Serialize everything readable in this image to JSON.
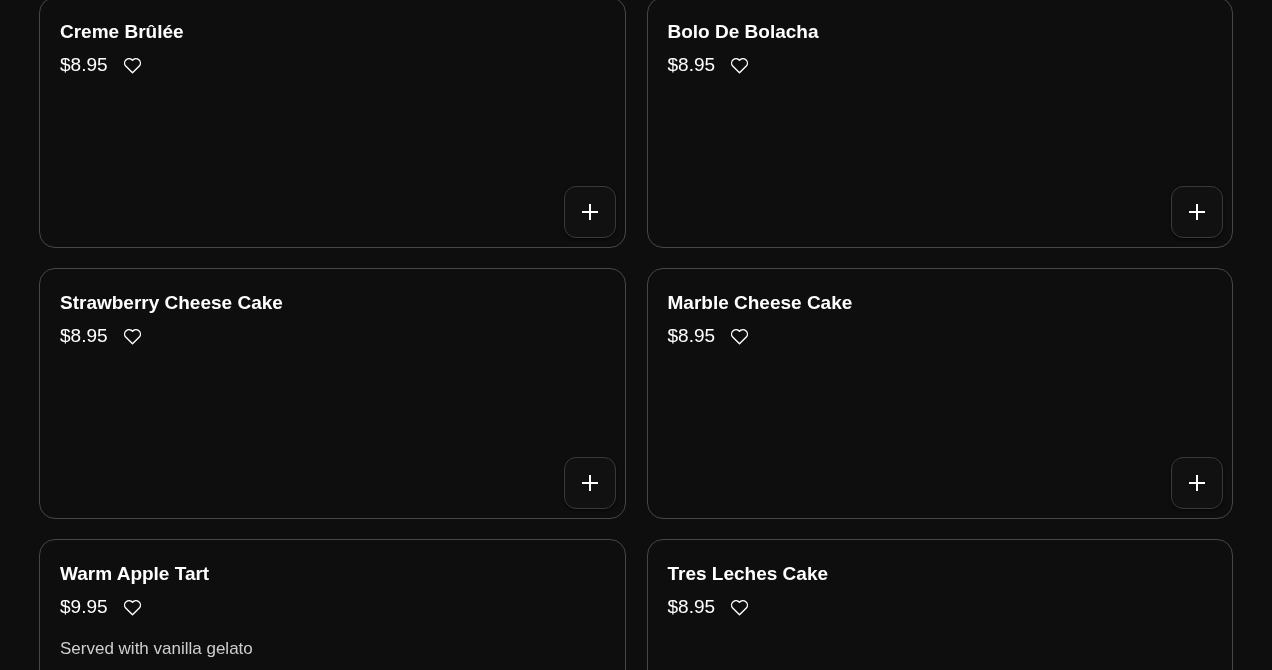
{
  "menu_items": [
    {
      "name": "Creme Brûlée",
      "price": "$8.95",
      "favorite": false
    },
    {
      "name": "Bolo De Bolacha",
      "price": "$8.95",
      "favorite": false
    },
    {
      "name": "Strawberry Cheese Cake",
      "price": "$8.95",
      "favorite": false
    },
    {
      "name": "Marble Cheese Cake",
      "price": "$8.95",
      "favorite": false
    },
    {
      "name": "Warm Apple Tart",
      "price": "$9.95",
      "favorite": false,
      "description": "Served with vanilla gelato"
    },
    {
      "name": "Tres Leches Cake",
      "price": "$8.95",
      "favorite": false
    }
  ]
}
